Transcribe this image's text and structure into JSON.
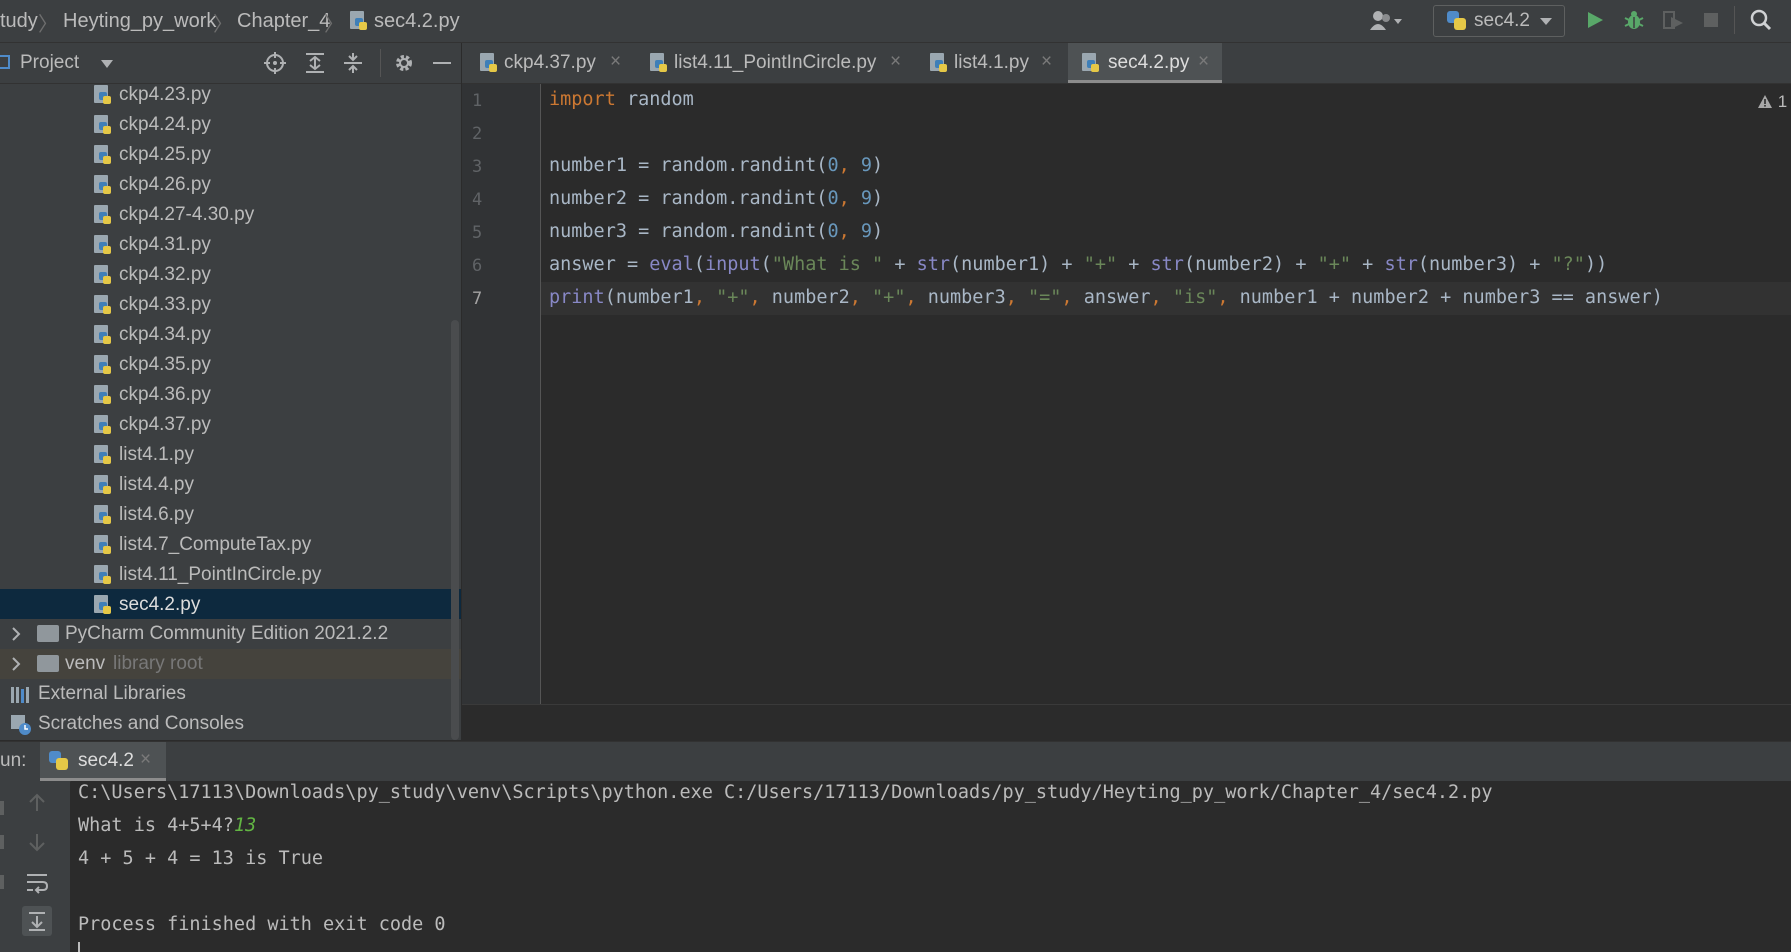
{
  "breadcrumb": {
    "items": [
      "tudy",
      "Heyting_py_work",
      "Chapter_4",
      "sec4.2.py"
    ]
  },
  "toolbar": {
    "run_config": "sec4.2",
    "user_icon": "user-icon",
    "run_icon": "run-icon",
    "debug_icon": "debug-icon",
    "coverage_icon": "coverage-icon",
    "stop_icon": "stop-icon",
    "search_icon": "search-icon"
  },
  "project_panel": {
    "title": "Project",
    "files": [
      "ckp4.23.py",
      "ckp4.24.py",
      "ckp4.25.py",
      "ckp4.26.py",
      "ckp4.27-4.30.py",
      "ckp4.31.py",
      "ckp4.32.py",
      "ckp4.33.py",
      "ckp4.34.py",
      "ckp4.35.py",
      "ckp4.36.py",
      "ckp4.37.py",
      "list4.1.py",
      "list4.4.py",
      "list4.6.py",
      "list4.7_ComputeTax.py",
      "list4.11_PointInCircle.py",
      "sec4.2.py"
    ],
    "selected_file": "sec4.2.py",
    "folders": [
      {
        "name": "PyCharm Community Edition 2021.2.2",
        "hint": ""
      },
      {
        "name": "venv",
        "hint": "library root"
      }
    ],
    "external_libraries": "External Libraries",
    "scratches": "Scratches and Consoles"
  },
  "editor_tabs": [
    {
      "label": "ckp4.37.py",
      "active": false
    },
    {
      "label": "list4.11_PointInCircle.py",
      "active": false
    },
    {
      "label": "list4.1.py",
      "active": false
    },
    {
      "label": "sec4.2.py",
      "active": true
    }
  ],
  "editor": {
    "line_numbers": [
      "1",
      "2",
      "3",
      "4",
      "5",
      "6",
      "7"
    ],
    "lines": [
      "import random",
      "",
      "number1 = random.randint(0, 9)",
      "number2 = random.randint(0, 9)",
      "number3 = random.randint(0, 9)",
      "answer = eval(input(\"What is \" + str(number1) + \"+\" + str(number2) + \"+\" + str(number3) + \"?\"))",
      "print(number1, \"+\", number2, \"+\", number3, \"=\", answer, \"is\", number1 + number2 + number3 == answer)"
    ],
    "warning_count": "1"
  },
  "run_panel": {
    "label": "un:",
    "tab": "sec4.2",
    "output": {
      "cmd": "C:\\Users\\17113\\Downloads\\py_study\\venv\\Scripts\\python.exe C:/Users/17113/Downloads/py_study/Heyting_py_work/Chapter_4/sec4.2.py",
      "prompt": "What is 4+5+4?",
      "user_input": "13",
      "result": "4 + 5 + 4 = 13 is True",
      "blank": "",
      "exit": "Process finished with exit code 0"
    }
  },
  "colors": {
    "background": "#2b2b2b",
    "panel": "#3c3f41",
    "keyword": "#cc7832",
    "string": "#6a8759",
    "number": "#6897bb",
    "builtin": "#8888c6",
    "selection": "#0d293e"
  }
}
